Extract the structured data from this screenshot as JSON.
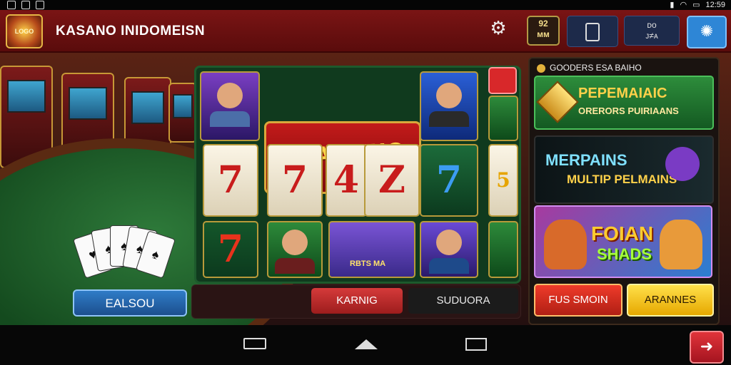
{
  "statusbar": {
    "signal": "▮",
    "wifi": "◠",
    "battery": "▭",
    "time": "12:59"
  },
  "header": {
    "logo": "LOGO",
    "title": "KASANO INIDOMEISN",
    "score_top": "92",
    "score_bottom": "ᴍᴍ",
    "stats_line1": "ᴅᴏ",
    "stats_line2": "ᴊ≠ᴀ"
  },
  "left": {
    "button_label": "EALSOU"
  },
  "board": {
    "logo_text": "IASSINO",
    "reels": [
      "7",
      "7",
      "4",
      "Z",
      "7",
      "5",
      "7"
    ],
    "small_label": "RBTS MA"
  },
  "bottom_actions": {
    "red_label": "KARNIG",
    "dark_label": "SUDUORA"
  },
  "panel": {
    "header": "GOODERS ESA BAIHO",
    "promo1_title": "PEPEMAIAIC",
    "promo1_sub": "ORERORS PUIRIAANS",
    "promo2_title": "MERPAINS",
    "promo2_sub": "MULTIP PELMAINS",
    "promo3_title": "FOIAN",
    "promo3_sub": "SHADS",
    "btn_red": "FUS SMOIN",
    "btn_yellow": "ARANNES"
  },
  "colors": {
    "accent_red": "#7a1414",
    "table_green": "#2e7a3a",
    "promo_yellow": "#ffe04a"
  }
}
